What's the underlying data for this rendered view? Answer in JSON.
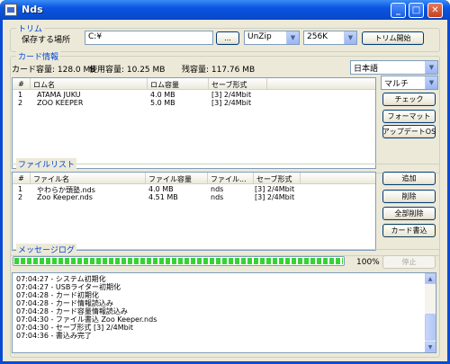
{
  "window": {
    "title": "Nds"
  },
  "trim": {
    "group_title": "トリム",
    "save_location_label": "保存する場所",
    "save_location_value": "C:¥",
    "browse_label": "...",
    "unzip_value": "UnZip",
    "size_value": "256K",
    "start_label": "トリム開始"
  },
  "card_info": {
    "group_title": "カード情報",
    "capacity": "カード容量: 128.0 MB",
    "used": "使用容量: 10.25 MB",
    "remaining": "残容量: 117.76 MB",
    "language_value": "日本語",
    "mode_value": "マルチ",
    "columns": [
      "#",
      "ロム名",
      "ロム容量",
      "セーブ形式"
    ],
    "rows": [
      [
        "1",
        "ATAMA JUKU",
        "4.0 MB",
        "[3] 2/4Mbit"
      ],
      [
        "2",
        "ZOO KEEPER",
        "5.0 MB",
        "[3] 2/4Mbit"
      ]
    ],
    "buttons": {
      "check": "チェック",
      "format": "フォーマット",
      "update_os": "アップデートOS"
    }
  },
  "file_list": {
    "group_title": "ファイルリスト",
    "columns": [
      "#",
      "ファイル名",
      "ファイル容量",
      "ファイル...",
      "セーブ形式"
    ],
    "rows": [
      [
        "1",
        "やわらか頭塾.nds",
        "4.0 MB",
        "nds",
        "[3] 2/4Mbit"
      ],
      [
        "2",
        "Zoo Keeper.nds",
        "4.51 MB",
        "nds",
        "[3] 2/4Mbit"
      ]
    ],
    "buttons": {
      "add": "追加",
      "delete": "削除",
      "delete_all": "全部削除",
      "card_write": "カード書込"
    }
  },
  "message_log": {
    "group_title": "メッセージログ",
    "progress_percent": 100,
    "progress_text": "100%",
    "stop_label": "停止",
    "lines": [
      "07:04:27 - システム初期化",
      "07:04:27 - USBライター初期化",
      "07:04:28 - カード初期化",
      "07:04:28 - カード情報読込み",
      "07:04:28 - カード容量情報読込み",
      "07:04:30 - ファイル書込 Zoo Keeper.nds",
      "07:04:30 - セーブ形式 [3] 2/4Mbit",
      "07:04:36 - 書込み完了"
    ]
  }
}
